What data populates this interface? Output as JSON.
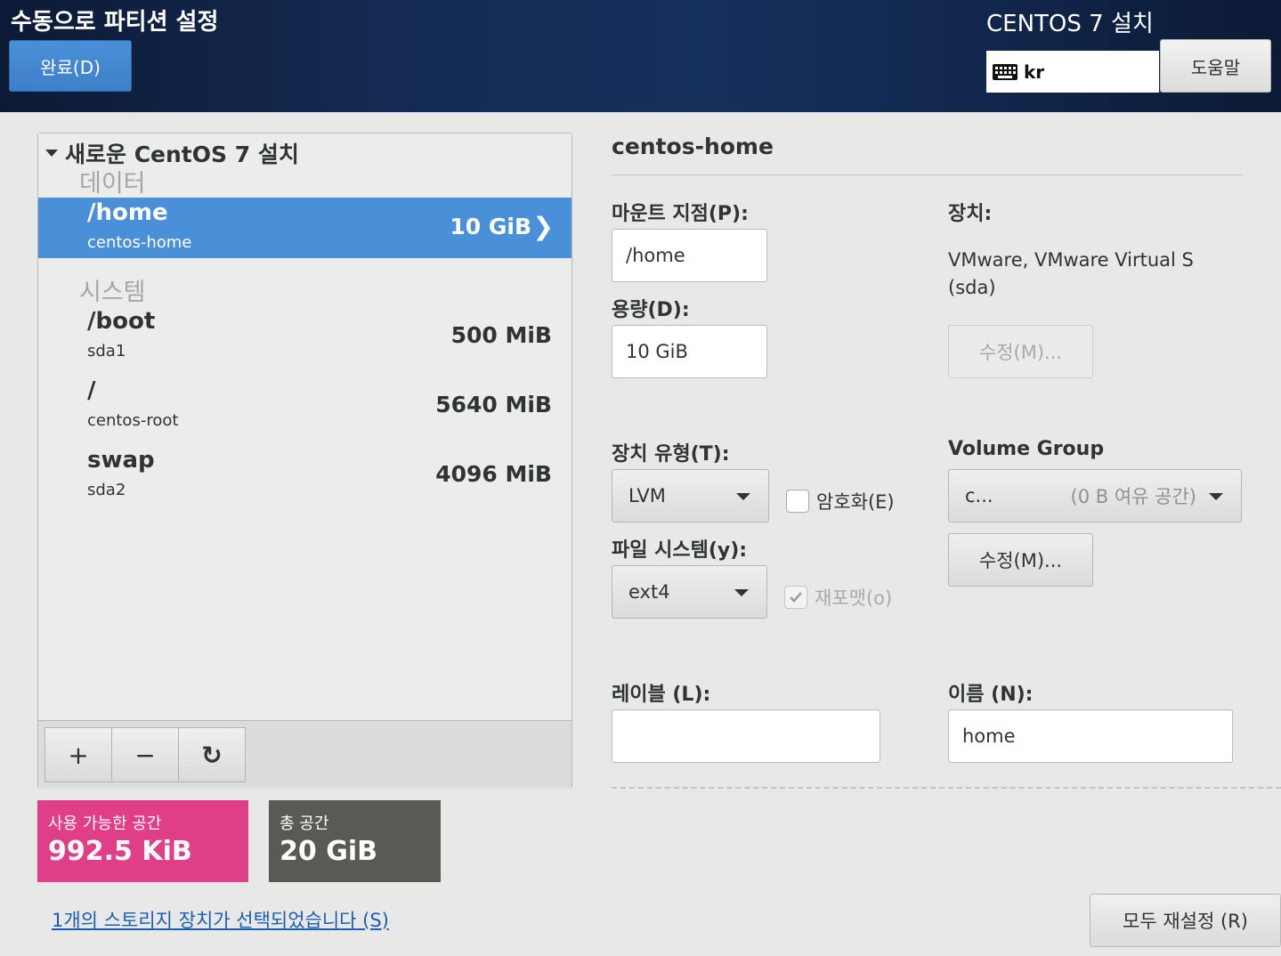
{
  "header": {
    "title": "수동으로 파티션 설정",
    "done_label": "완료(D)",
    "product": "CENTOS 7 설치",
    "keyboard_layout": "kr",
    "help_label": "도움말"
  },
  "tree": {
    "root_label": "새로운 CentOS 7 설치",
    "groups": [
      {
        "label": "데이터",
        "items": [
          {
            "mount": "/home",
            "device": "centos-home",
            "size": "10 GiB",
            "selected": true
          }
        ]
      },
      {
        "label": "시스템",
        "items": [
          {
            "mount": "/boot",
            "device": "sda1",
            "size": "500 MiB"
          },
          {
            "mount": "/",
            "device": "centos-root",
            "size": "5640 MiB"
          },
          {
            "mount": "swap",
            "device": "sda2",
            "size": "4096 MiB"
          }
        ]
      }
    ]
  },
  "toolbar": {
    "add": "+",
    "remove": "−",
    "refresh": "↻"
  },
  "space": {
    "available_label": "사용 가능한 공간",
    "available_value": "992.5 KiB",
    "total_label": "총 공간",
    "total_value": "20 GiB"
  },
  "storage_link": "1개의 스토리지 장치가 선택되었습니다 (S)",
  "detail": {
    "title": "centos-home",
    "mount_label": "마운트 지점(P):",
    "mount_value": "/home",
    "capacity_label": "용량(D):",
    "capacity_value": "10 GiB",
    "device_label": "장치:",
    "device_line1": "VMware, VMware Virtual S",
    "device_line2": "(sda)",
    "modify_label": "수정(M)...",
    "device_type_label": "장치 유형(T):",
    "device_type_value": "LVM",
    "encrypt_label": "암호화(E)",
    "fs_label": "파일 시스템(y):",
    "fs_value": "ext4",
    "reformat_label": "재포맷(o)",
    "vg_label": "Volume Group",
    "vg_value": "c...",
    "vg_free": "(0 B 여유 공간)",
    "vg_modify_label": "수정(M)...",
    "label_label": "레이블 (L):",
    "label_value": "",
    "name_label": "이름 (N):",
    "name_value": "home",
    "reset_label": "모두 재설정 (R)"
  },
  "colors": {
    "selected_row": "#4a90d9",
    "available_space": "#e03e87",
    "total_space": "#5a5a55",
    "header_bg": "#142a52"
  }
}
